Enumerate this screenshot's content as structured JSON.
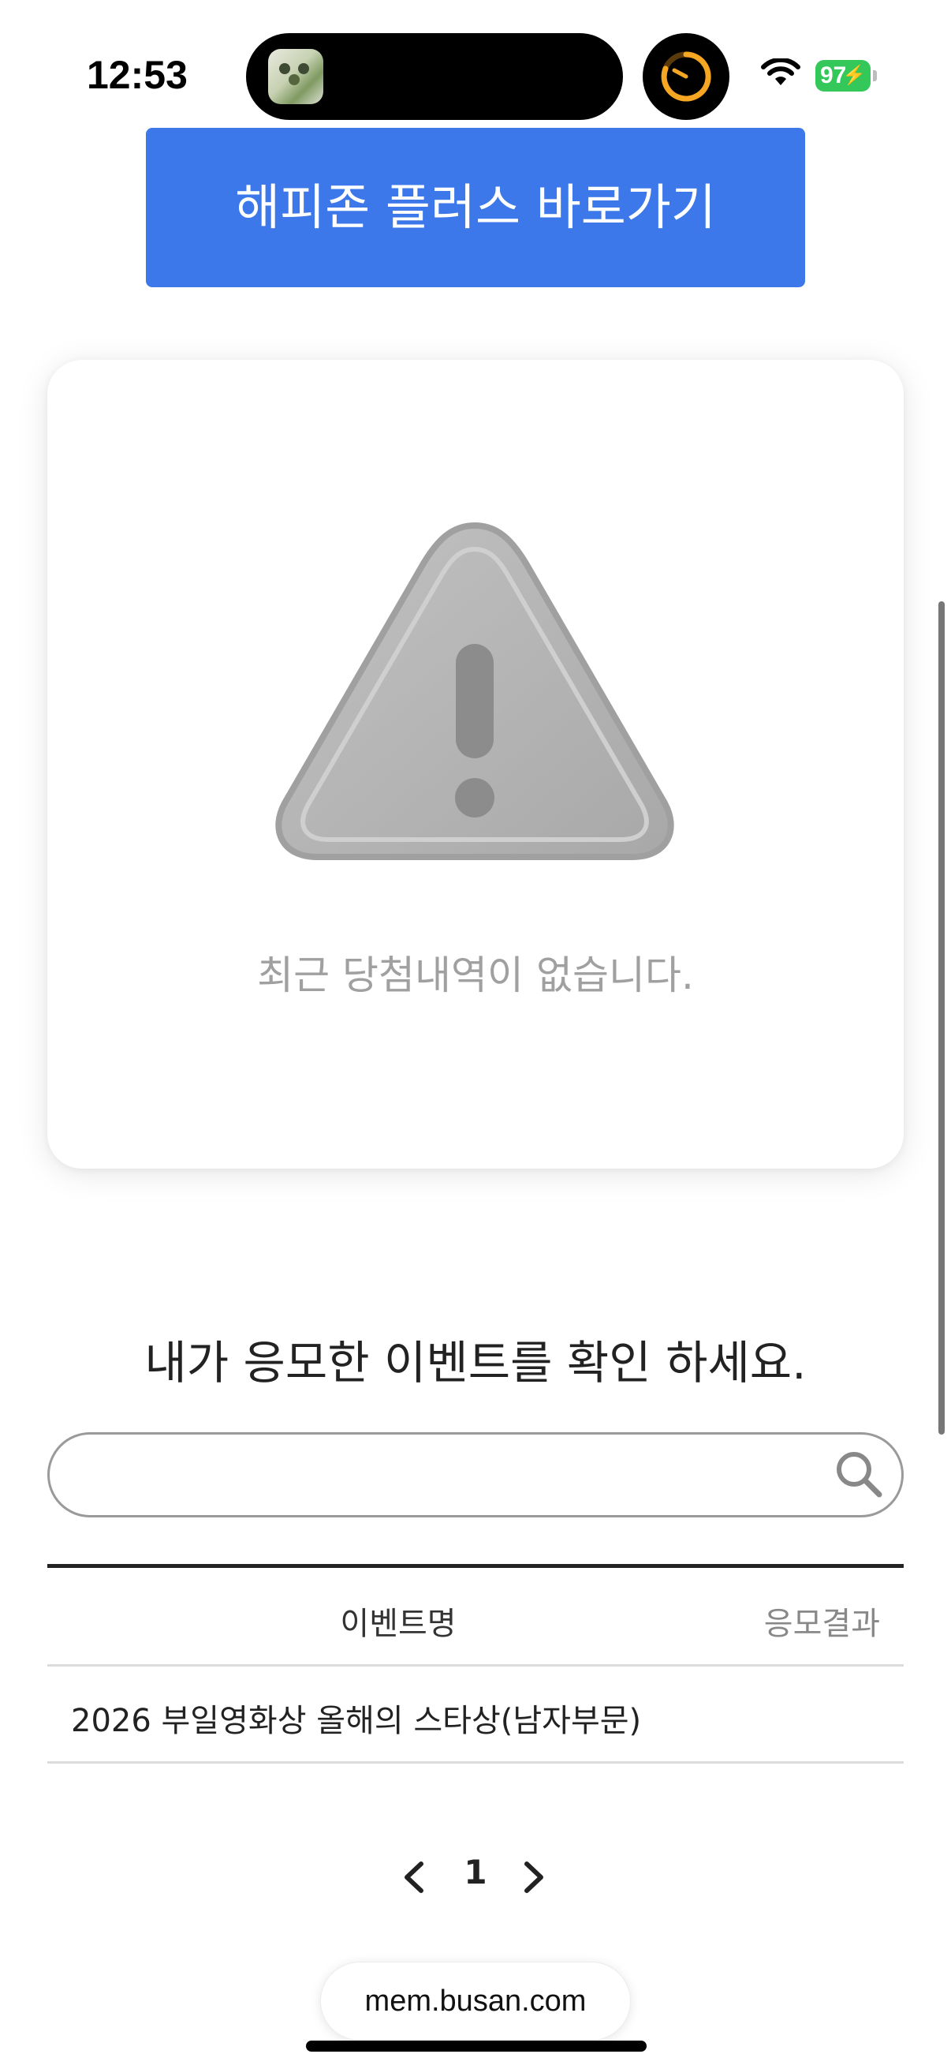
{
  "status_bar": {
    "time": "12:53",
    "battery": "97"
  },
  "cta": {
    "label": "해피존 플러스 바로가기"
  },
  "empty_state": {
    "icon": "warning-triangle-icon",
    "message": "최근 당첨내역이 없습니다."
  },
  "events": {
    "title": "내가 응모한 이벤트를 확인 하세요.",
    "search": {
      "value": "",
      "placeholder": ""
    },
    "columns": [
      "이벤트명",
      "응모결과"
    ],
    "rows": [
      {
        "name": "2026 부일영화상 올해의 스타상(남자부문)",
        "result": ""
      }
    ]
  },
  "pagination": {
    "current": "1"
  },
  "browser": {
    "url": "mem.busan.com"
  },
  "colors": {
    "accent": "#3c78ea",
    "battery": "#34c759",
    "timer": "#f5a623"
  }
}
